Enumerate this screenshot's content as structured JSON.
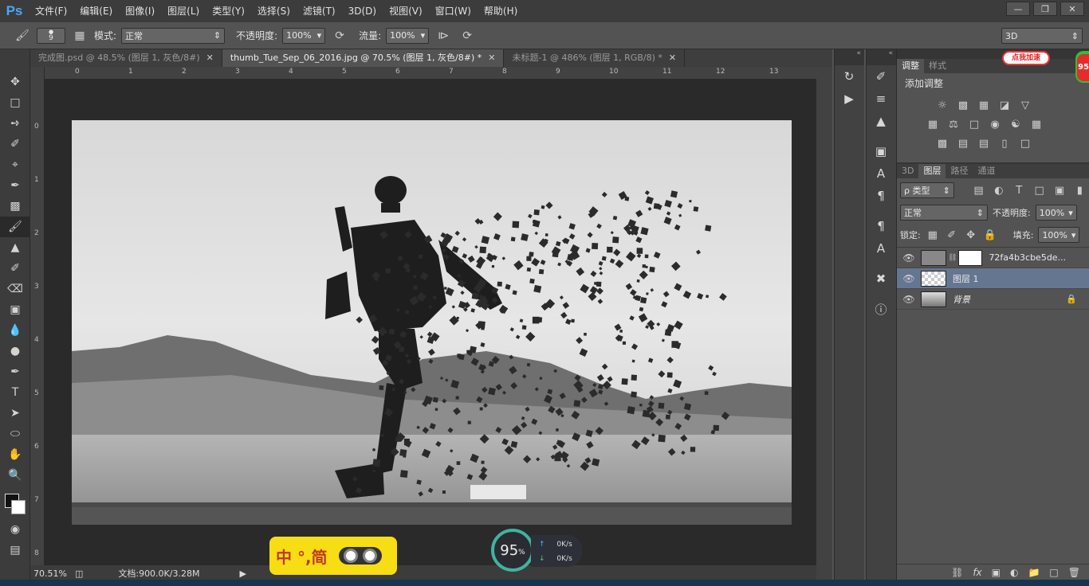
{
  "app": {
    "logo": "Ps"
  },
  "menu": [
    "文件(F)",
    "编辑(E)",
    "图像(I)",
    "图层(L)",
    "类型(Y)",
    "选择(S)",
    "滤镜(T)",
    "3D(D)",
    "视图(V)",
    "窗口(W)",
    "帮助(H)"
  ],
  "options": {
    "brush_size": "9",
    "mode_label": "模式:",
    "mode_value": "正常",
    "opacity_label": "不透明度:",
    "opacity_value": "100%",
    "flow_label": "流量:",
    "flow_value": "100%",
    "workspace": "3D"
  },
  "tabs": [
    {
      "label": "完成图.psd @ 48.5% (图层 1, 灰色/8#)"
    },
    {
      "label": "thumb_Tue_Sep_06_2016.jpg @ 70.5% (图层 1, 灰色/8#) *"
    },
    {
      "label": "未标题-1 @ 486% (图层 1, RGB/8) *"
    }
  ],
  "ruler_h": [
    "0",
    "1",
    "2",
    "3",
    "4",
    "5",
    "6",
    "7",
    "8",
    "9",
    "10",
    "11",
    "12",
    "13"
  ],
  "ruler_v": [
    "0",
    "1",
    "2",
    "3",
    "4",
    "5",
    "6",
    "7",
    "8"
  ],
  "status": {
    "zoom": "70.51%",
    "doc": "文档:900.0K/3.28M"
  },
  "adjust": {
    "tabs": [
      "调整",
      "样式"
    ],
    "title": "添加调整",
    "badge": "点我加速",
    "badge_num": "95"
  },
  "layers_panel": {
    "tabs": [
      "3D",
      "图层",
      "路径",
      "通道"
    ],
    "filter": "ρ 类型",
    "blend": "正常",
    "opacity_label": "不透明度:",
    "opacity": "100%",
    "lock_label": "锁定:",
    "fill_label": "填充:",
    "fill": "100%",
    "layers": [
      {
        "name": "72fa4b3cbe5de..."
      },
      {
        "name": "图层 1"
      },
      {
        "name": "背景"
      }
    ]
  },
  "ime": {
    "text": "中 °,简"
  },
  "speed": {
    "percent": "95",
    "unit": "%",
    "up": "0",
    "down": "0",
    "rate_unit": "K/s"
  }
}
